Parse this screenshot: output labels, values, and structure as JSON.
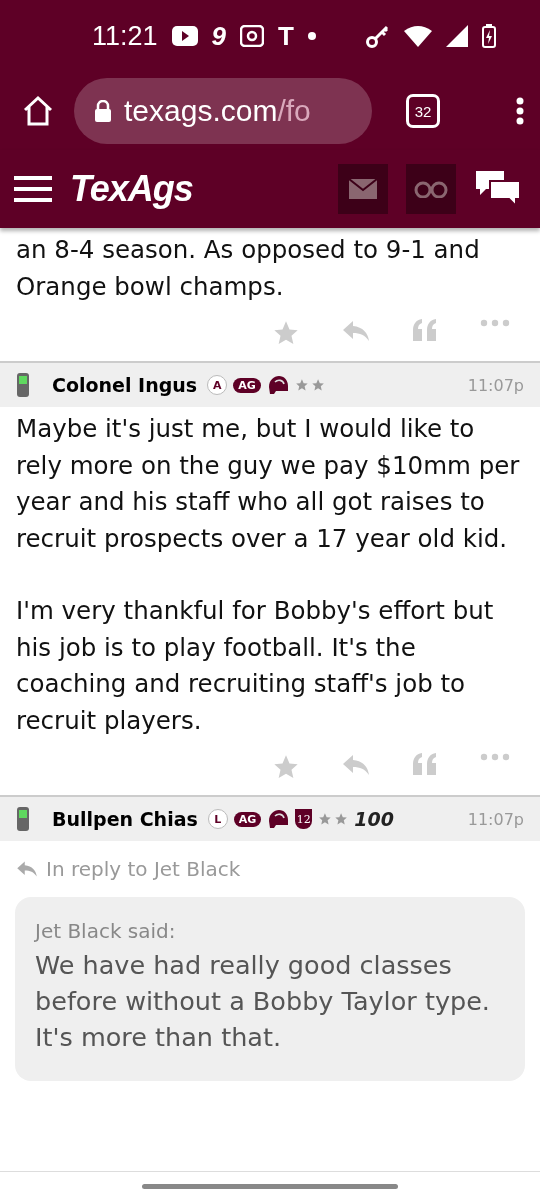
{
  "status_bar": {
    "time": "11:21",
    "notification_letters": [
      "9",
      "T"
    ]
  },
  "browser": {
    "url_host": "texags.com",
    "url_path": "/fo",
    "tab_count": "32"
  },
  "site_header": {
    "logo": "TexAgs"
  },
  "posts": [
    {
      "kind": "tail",
      "paragraphs": [
        "an 8-4 season. As opposed to 9-1 and Orange bowl champs."
      ]
    },
    {
      "kind": "full",
      "author": "Colonel Ingus",
      "time": "11:07p",
      "badges": [
        {
          "kind": "letter",
          "text": "A"
        },
        {
          "kind": "pill",
          "text": "AG"
        },
        {
          "kind": "helmet"
        },
        {
          "kind": "stars_badge"
        }
      ],
      "paragraphs": [
        "Maybe it's just me, but I would like to rely more on the guy we pay $10mm per year and his staff who all got raises to recruit prospects over a 17 year old kid.",
        "I'm very thankful for Bobby's effort but his job is to play football. It's the coaching and recruiting staff's job to recruit players."
      ]
    },
    {
      "kind": "reply",
      "author": "Bullpen Chias",
      "time": "11:07p",
      "badges": [
        {
          "kind": "letter",
          "text": "L"
        },
        {
          "kind": "pill",
          "text": "AG"
        },
        {
          "kind": "helmet"
        },
        {
          "kind": "shield",
          "text": "12"
        },
        {
          "kind": "stars_badge"
        },
        {
          "kind": "hundred",
          "text": "100"
        }
      ],
      "reply_to": "In reply to Jet Black",
      "quote": {
        "attribution": "Jet Black said:",
        "text": "We have had really good classes before without a Bobby Taylor type. It's more than that."
      }
    }
  ]
}
